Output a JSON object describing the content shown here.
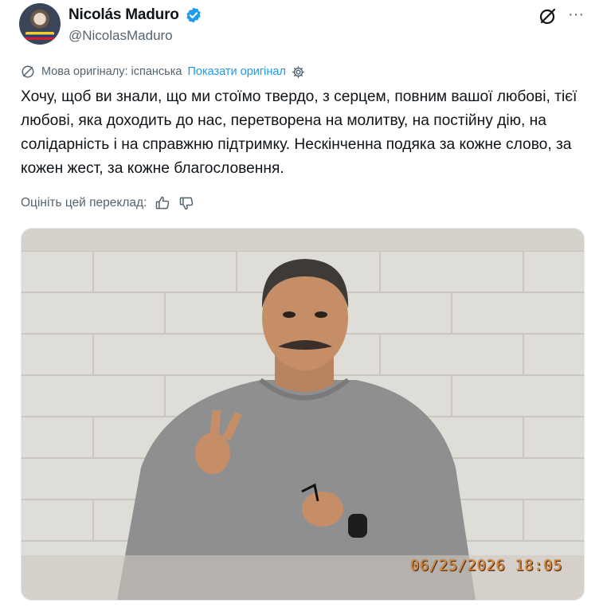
{
  "author": {
    "name": "Nicolás Maduro",
    "handle": "@NicolasMaduro",
    "verified_color": "#1d9bf0"
  },
  "icons": {
    "grok": "grok-icon",
    "more": "more-icon",
    "more_glyph": "···",
    "language": "translate-icon",
    "settings": "gear-icon",
    "thumbs_up": "thumbs-up-icon",
    "thumbs_down": "thumbs-down-icon"
  },
  "translation": {
    "original_language": "Мова оригіналу: іспанська",
    "show_original": "Показати оригінал"
  },
  "tweet_text": "Хочу, щоб ви знали, що ми стоїмо твердо, з серцем, повним вашої любові, тієї любові, яка доходить до нас, перетворена на молитву, на постійну дію, на солідарність і на справжню підтримку. Нескінченна подяка за кожне слово, за кожен жест, за кожне благословення.",
  "rate_translation": "Оцініть цей переклад:",
  "media": {
    "timestamp": "06/25/2026  18:05"
  },
  "colors": {
    "text": "#0f1419",
    "secondary": "#536471",
    "link": "#1d9bf0"
  }
}
